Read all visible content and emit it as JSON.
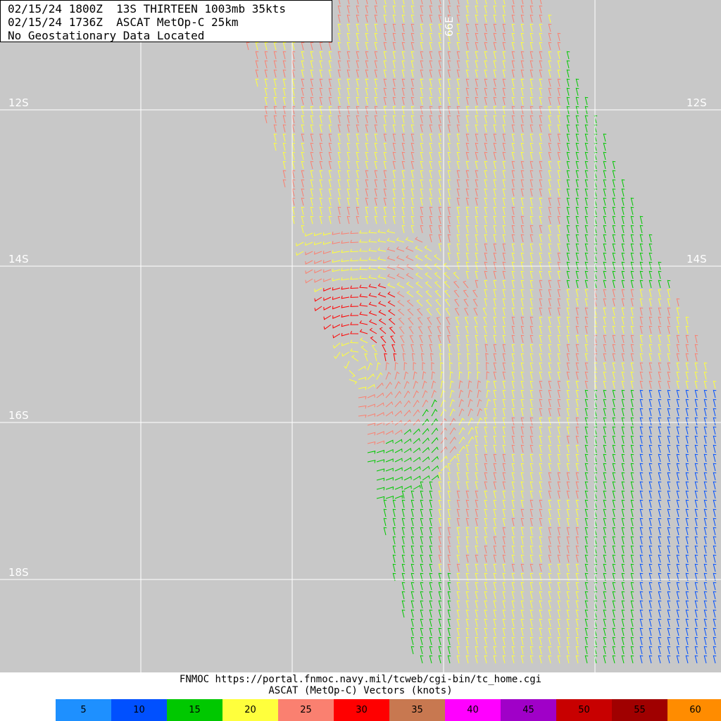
{
  "header": {
    "line1": "02/15/24 1800Z  13S THIRTEEN 1003mb 35kts",
    "line2": "02/15/24 1736Z  ASCAT MetOp-C 25km",
    "line3": "No Geostationary Data Located"
  },
  "map": {
    "background_color": "#c8c8c8",
    "grid_color": "#ffffff",
    "latitude_labels": [
      "12S",
      "14S",
      "16S",
      "18S"
    ],
    "longitude_labels": [
      "66E"
    ],
    "storm_center": "near 15.3S 65.2E (visible low-level circulation)"
  },
  "footer": {
    "credit": "FNMOC https://portal.fnmoc.navy.mil/tcweb/cgi-bin/tc_home.cgi",
    "product": "ASCAT (MetOp-C) Vectors (knots)"
  },
  "legend": [
    {
      "label": "5",
      "color": "#1e90ff"
    },
    {
      "label": "10",
      "color": "#0050ff"
    },
    {
      "label": "15",
      "color": "#00c800"
    },
    {
      "label": "20",
      "color": "#ffff3c"
    },
    {
      "label": "25",
      "color": "#fa8070"
    },
    {
      "label": "30",
      "color": "#ff0000"
    },
    {
      "label": "35",
      "color": "#c87850"
    },
    {
      "label": "40",
      "color": "#ff00ff"
    },
    {
      "label": "45",
      "color": "#a000c8"
    },
    {
      "label": "50",
      "color": "#c80000"
    },
    {
      "label": "55",
      "color": "#a00000"
    },
    {
      "label": "60",
      "color": "#ff8c00"
    }
  ]
}
